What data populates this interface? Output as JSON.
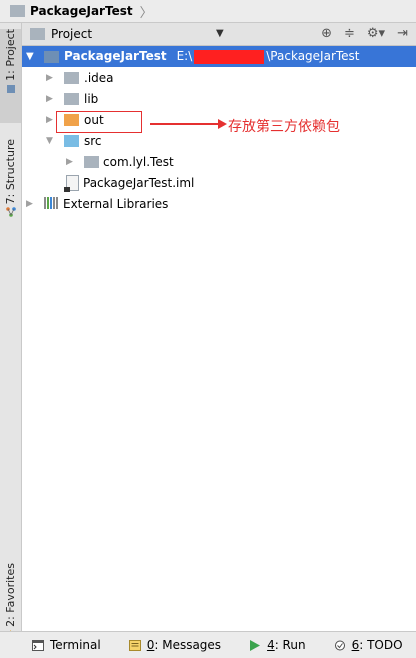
{
  "breadcrumb": {
    "title": "PackageJarTest",
    "separator": "〉"
  },
  "left_tabs": {
    "project": "1: Project",
    "structure": "7: Structure",
    "favorites": "2: Favorites"
  },
  "panel": {
    "title": "Project"
  },
  "tree": {
    "root": {
      "name": "PackageJarTest",
      "path_prefix": "E:\\",
      "path_suffix": "\\PackageJarTest"
    },
    "items": [
      {
        "label": ".idea"
      },
      {
        "label": "lib"
      },
      {
        "label": "out"
      },
      {
        "label": "src"
      },
      {
        "label": "com.lyl.Test"
      },
      {
        "label": "PackageJarTest.iml"
      },
      {
        "label": "External Libraries"
      }
    ]
  },
  "annotation": {
    "text": "存放第三方依赖包",
    "color": "#e53030"
  },
  "bottom_tools": [
    {
      "label": "Terminal"
    },
    {
      "num": "0",
      "label": ": Messages"
    },
    {
      "num": "4",
      "label": ": Run"
    },
    {
      "num": "6",
      "label": ": TODO"
    }
  ],
  "colors": {
    "selection": "#3875d7",
    "annotation": "#e53030",
    "folder_orange": "#f0a24a",
    "folder_cyan": "#79bce4"
  }
}
